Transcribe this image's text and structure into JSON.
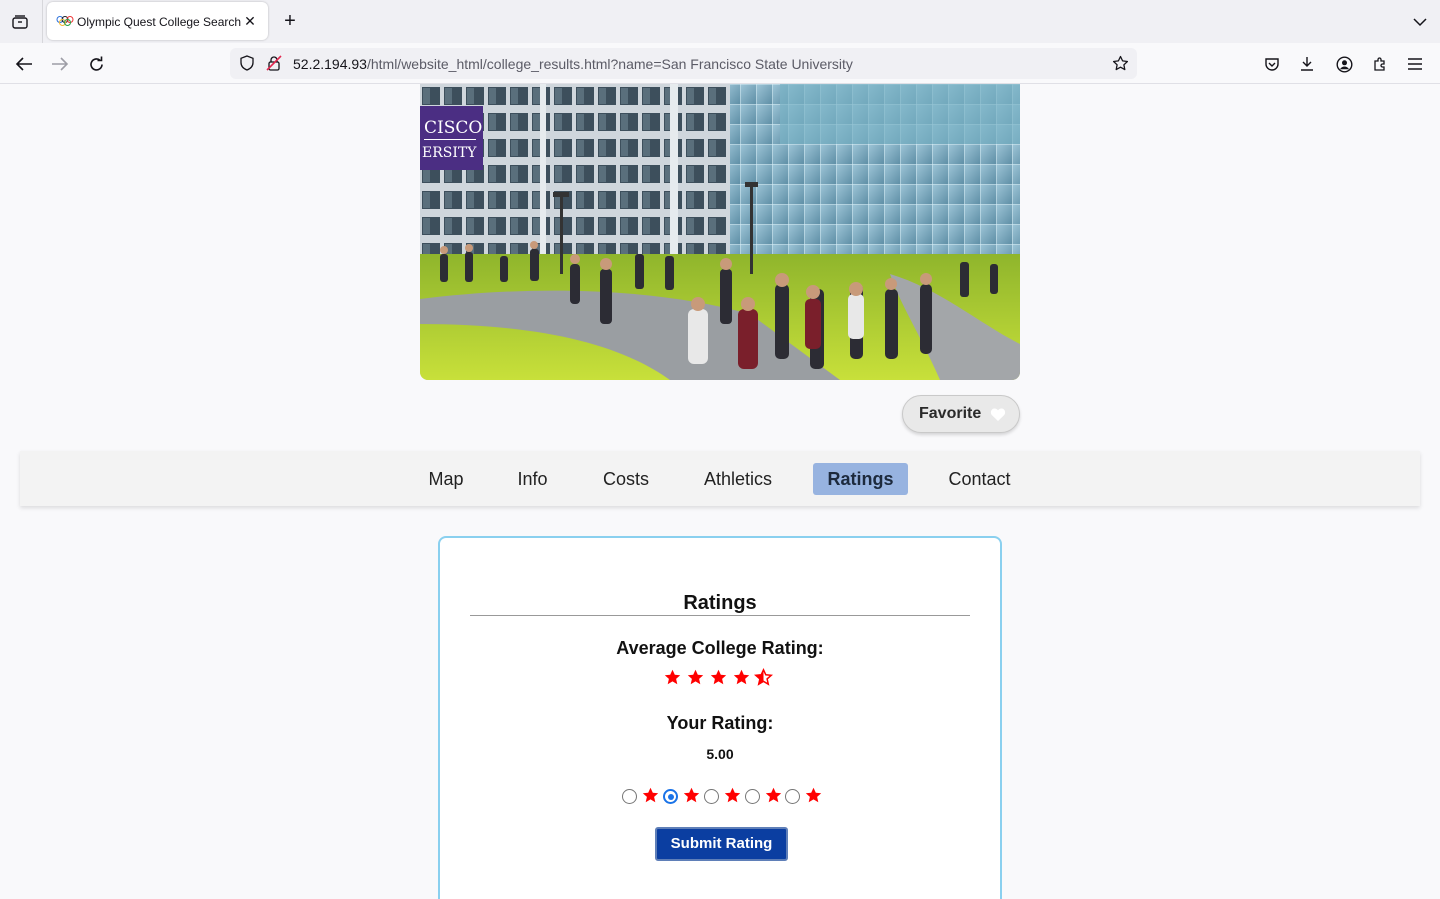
{
  "browser": {
    "tab_title": "Olympic Quest College Search",
    "url_host": "52.2.194.93",
    "url_path": "/html/website_html/college_results.html?name=San Francisco State University",
    "icons": [
      "tab-list-icon",
      "olympic-rings-icon",
      "close-icon",
      "plus-icon",
      "chevron-down-icon",
      "back-arrow-icon",
      "forward-arrow-icon",
      "reload-icon",
      "shield-icon",
      "insecure-lock-icon",
      "star-icon",
      "pocket-icon",
      "download-icon",
      "account-icon",
      "extensions-icon",
      "menu-icon"
    ]
  },
  "hero": {
    "banner_text_line1": "CISCO",
    "banner_text_line2": "ERSITY",
    "accent": "#4b2e83"
  },
  "favorite": {
    "label": "Favorite",
    "icon": "heart-icon"
  },
  "tabs": [
    {
      "label": "Map",
      "active": false
    },
    {
      "label": "Info",
      "active": false
    },
    {
      "label": "Costs",
      "active": false
    },
    {
      "label": "Athletics",
      "active": false
    },
    {
      "label": "Ratings",
      "active": true
    },
    {
      "label": "Contact",
      "active": false
    }
  ],
  "ratings": {
    "title": "Ratings",
    "average_label": "Average College Rating:",
    "average_stars": 4.5,
    "your_label": "Your Rating:",
    "your_value": "5.00",
    "options_count": 5,
    "selected_option": 2,
    "submit_label": "Submit Rating",
    "star_color": "#ff0000",
    "button_color": "#0b3ea1"
  }
}
